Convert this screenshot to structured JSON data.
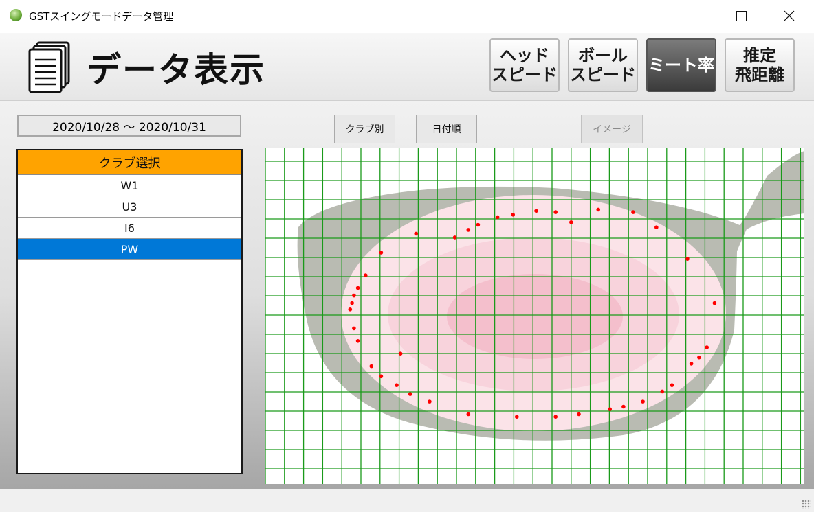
{
  "window": {
    "title": "GSTスイングモードデータ管理"
  },
  "header": {
    "title": "データ表示",
    "mode_buttons": [
      {
        "label": "ヘッド\nスピード",
        "active": false
      },
      {
        "label": "ボール\nスピード",
        "active": false
      },
      {
        "label": "ミート率",
        "active": true
      },
      {
        "label": "推定\n飛距離",
        "active": false
      }
    ]
  },
  "filters": {
    "date_range": "2020/10/28 ～ 2020/10/31",
    "by_club_button": "クラブ別",
    "by_date_button": "日付順",
    "image_button": "イメージ"
  },
  "club_list": {
    "header": "クラブ選択",
    "items": [
      "W1",
      "U3",
      "I6",
      "PW"
    ],
    "selected": "PW"
  },
  "colors": {
    "club_header": "#ffa300",
    "selection": "#0078d7",
    "grid": "#1a9a1a",
    "hit_dot": "#ff0000",
    "club_face": "#b9bbb2",
    "sweet_spot_outer": "#fbe3e8",
    "sweet_spot_inner": "#f4b8c8"
  },
  "chart_data": {
    "type": "scatter",
    "description": "hit impact points plotted on club face",
    "points": [
      [
        -0.42,
        0.62
      ],
      [
        -0.35,
        0.68
      ],
      [
        -0.3,
        0.72
      ],
      [
        -0.2,
        0.78
      ],
      [
        -0.12,
        0.8
      ],
      [
        0.0,
        0.83
      ],
      [
        0.1,
        0.82
      ],
      [
        0.18,
        0.74
      ],
      [
        0.32,
        0.84
      ],
      [
        0.5,
        0.82
      ],
      [
        0.62,
        0.7
      ],
      [
        0.78,
        0.45
      ],
      [
        0.92,
        0.1
      ],
      [
        0.88,
        -0.25
      ],
      [
        0.84,
        -0.33
      ],
      [
        0.8,
        -0.38
      ],
      [
        0.7,
        -0.55
      ],
      [
        0.65,
        -0.6
      ],
      [
        0.55,
        -0.68
      ],
      [
        0.45,
        -0.72
      ],
      [
        0.38,
        -0.74
      ],
      [
        0.22,
        -0.78
      ],
      [
        0.1,
        -0.8
      ],
      [
        -0.1,
        -0.8
      ],
      [
        -0.35,
        -0.78
      ],
      [
        -0.55,
        -0.68
      ],
      [
        -0.65,
        -0.62
      ],
      [
        -0.72,
        -0.55
      ],
      [
        -0.8,
        -0.48
      ],
      [
        -0.85,
        -0.4
      ],
      [
        -0.92,
        -0.2
      ],
      [
        -0.94,
        -0.1
      ],
      [
        -0.96,
        0.05
      ],
      [
        -0.95,
        0.1
      ],
      [
        -0.94,
        0.16
      ],
      [
        -0.92,
        0.22
      ],
      [
        -0.88,
        0.32
      ],
      [
        -0.8,
        0.5
      ],
      [
        -0.62,
        0.65
      ],
      [
        -0.7,
        -0.3
      ]
    ]
  }
}
